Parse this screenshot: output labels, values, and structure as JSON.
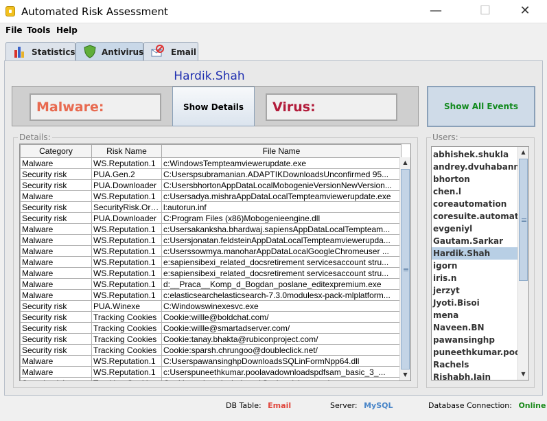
{
  "window": {
    "title": "Automated Risk Assessment",
    "minimize_glyph": "—",
    "maximize_glyph": "☐",
    "close_glyph": "✕"
  },
  "menu": [
    "File",
    "Tools",
    "Help"
  ],
  "tabs": [
    {
      "label": "Statistics",
      "icon": "bar-chart-icon"
    },
    {
      "label": "Antivirus",
      "icon": "shield-icon"
    },
    {
      "label": "Email",
      "icon": "email-icon"
    }
  ],
  "active_tab": "Antivirus",
  "selected_user_display": "Hardik.Shah",
  "summary": {
    "malware_label": "Malware:",
    "virus_label": "Virus:",
    "show_details_label": "Show Details",
    "show_all_label": "Show All Events"
  },
  "details": {
    "title": "Details:",
    "columns": [
      "Category",
      "Risk Name",
      "File Name"
    ],
    "rows": [
      [
        "Malware",
        "WS.Reputation.1",
        "c:WindowsTempteamviewerupdate.exe"
      ],
      [
        "Security risk",
        "PUA.Gen.2",
        "C:Userspsubramanian.ADAPTIKDownloadsUnconfirmed 95..."
      ],
      [
        "Security risk",
        "PUA.Downloader",
        "C:UsersbhortonAppDataLocalMobogenieVersionNewVersion..."
      ],
      [
        "Malware",
        "WS.Reputation.1",
        "c:Usersadya.mishraAppDataLocalTempteamviewerupdate.exe"
      ],
      [
        "Security risk",
        "SecurityRisk.Orp...",
        "l:autorun.inf"
      ],
      [
        "Security risk",
        "PUA.Downloader",
        "C:Program Files (x86)Mobogenieengine.dll"
      ],
      [
        "Malware",
        "WS.Reputation.1",
        "c:Usersakanksha.bhardwaj.sapiensAppDataLocalTempteam..."
      ],
      [
        "Malware",
        "WS.Reputation.1",
        "c:Usersjonatan.feldsteinAppDataLocalTempteamviewerupda..."
      ],
      [
        "Malware",
        "WS.Reputation.1",
        "c:Userssowmya.manoharAppDataLocalGoogleChromeuser ..."
      ],
      [
        "Malware",
        "WS.Reputation.1",
        "e:sapiensibexi_related_docsretirement servicesaccount stru..."
      ],
      [
        "Malware",
        "WS.Reputation.1",
        "e:sapiensibexi_related_docsretirement servicesaccount stru..."
      ],
      [
        "Malware",
        "WS.Reputation.1",
        "d:__Praca__Komp_d_Bogdan_poslane_editexpremium.exe"
      ],
      [
        "Malware",
        "WS.Reputation.1",
        "c:elasticsearchelasticsearch-7.3.0modulesx-pack-mlplatform..."
      ],
      [
        "Security risk",
        "PUA.Winexe",
        "C:Windowswinexesvc.exe"
      ],
      [
        "Security risk",
        "Tracking Cookies",
        "Cookie:willle@boldchat.com/"
      ],
      [
        "Security risk",
        "Tracking Cookies",
        "Cookie:willle@smartadserver.com/"
      ],
      [
        "Security risk",
        "Tracking Cookies",
        "Cookie:tanay.bhakta@rubiconproject.com/"
      ],
      [
        "Security risk",
        "Tracking Cookies",
        "Cookie:sparsh.chrungoo@doubleclick.net/"
      ],
      [
        "Malware",
        "WS.Reputation.1",
        "C:UserspawansinghpDownloadsSQLinFormNpp64.dll"
      ],
      [
        "Malware",
        "WS.Reputation.1",
        "c:Userspuneethkumar.poolavadownloadspdfsam_basic_3_..."
      ],
      [
        "Security risk",
        "Tracking Cookies",
        "Cookie:andrey.dvuhabanni@advertising.com/"
      ]
    ]
  },
  "users": {
    "title": "Users:",
    "items": [
      "abhishek.shukla",
      "andrey.dvuhabanni",
      "bhorton",
      "chen.l",
      "coreautomation",
      "coresuite.automation",
      "evgeniyl",
      "Gautam.Sarkar",
      "Hardik.Shah",
      "igorn",
      "iris.n",
      "jerzyt",
      "Jyoti.Bisoi",
      "mena",
      "Naveen.BN",
      "pawansinghp",
      "puneethkumar.poolava",
      "Rachels",
      "Rishabh.Jain"
    ],
    "selected": "Hardik.Shah"
  },
  "status": {
    "db_table_label": "DB Table:",
    "db_table_value": "Email",
    "server_label": "Server:",
    "server_value": "MySQL",
    "connection_label": "Database Connection:",
    "connection_value": "Online"
  },
  "colors": {
    "db_table": "#e0463c",
    "server": "#4a86c8",
    "online": "#1a8a1a"
  }
}
